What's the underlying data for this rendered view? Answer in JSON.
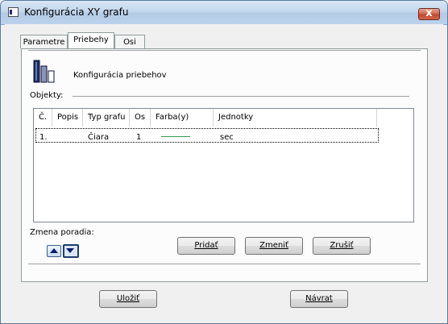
{
  "window": {
    "title": "Konfigurácia XY grafu",
    "close_label": "x",
    "icon": "window-app-icon"
  },
  "tabs": [
    {
      "label": "Parametre",
      "active": false
    },
    {
      "label": "Priebehy",
      "active": true
    },
    {
      "label": "Osi",
      "active": false
    }
  ],
  "header": {
    "label": "Konfigurácia priebehov",
    "icon": "bar-chart-icon"
  },
  "objects": {
    "group_label": "Objekty:",
    "columns": [
      "Č.",
      "Popis",
      "Typ grafu",
      "Os",
      "Farba(y)",
      "Jednotky"
    ],
    "rows": [
      {
        "num": "1.",
        "popis": "",
        "typ": "Čiara",
        "os": "1",
        "farba": "#2e9e4f",
        "jednotky": "sec"
      }
    ]
  },
  "order": {
    "label": "Zmena poradia:",
    "up_icon": "arrow-up-icon",
    "down_icon": "arrow-down-icon"
  },
  "actions": {
    "add": "Pridať",
    "change": "Zmeniť",
    "delete": "Zrušiť"
  },
  "footer": {
    "save": "Uložiť",
    "back": "Návrat"
  }
}
